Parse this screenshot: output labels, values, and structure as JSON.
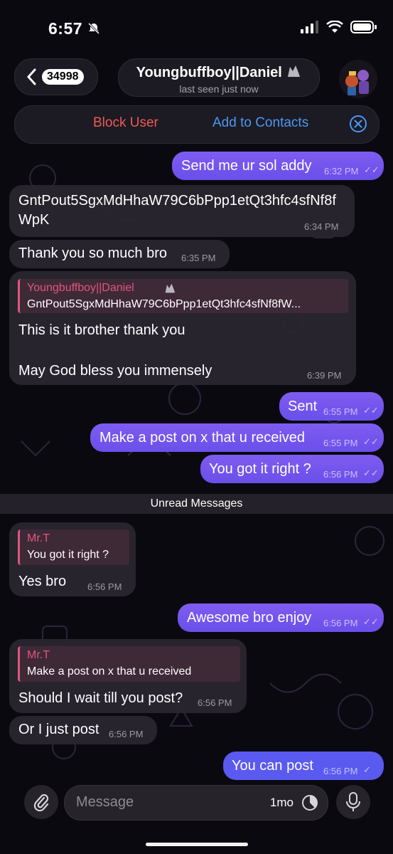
{
  "status_bar": {
    "time": "6:57"
  },
  "header": {
    "unread_count": "34998",
    "chat_title": "Youngbuffboy||Daniel",
    "last_seen": "last seen just now"
  },
  "actions": {
    "block": "Block User",
    "add_contact": "Add to Contacts"
  },
  "messages": [
    {
      "text": "Send me ur sol addy",
      "time": "6:32 PM"
    },
    {
      "text": "GntPout5SgxMdHhaW79C6bPpp1etQt3hfc4sfNf8fWpK",
      "time": "6:34 PM"
    },
    {
      "text": "Thank you so much bro",
      "time": "6:35 PM"
    },
    {
      "reply_name": "Youngbuffboy||Daniel",
      "reply_text": "GntPout5SgxMdHhaW79C6bPpp1etQt3hfc4sfNf8fW...",
      "text": "This is it brother thank you",
      "text2": "May God bless you immensely",
      "time": "6:39 PM"
    },
    {
      "text": "Sent",
      "time": "6:55 PM"
    },
    {
      "text": "Make a post on x that u received",
      "time": "6:55 PM"
    },
    {
      "text": "You got it right ?",
      "time": "6:56 PM"
    },
    {
      "reply_name": "Mr.T",
      "reply_text": "You got it right ?",
      "text": "Yes bro",
      "time": "6:56 PM"
    },
    {
      "text": "Awesome bro enjoy",
      "time": "6:56 PM"
    },
    {
      "reply_name": "Mr.T",
      "reply_text": "Make a post on x that u received",
      "text": "Should I wait till you post?",
      "time": "6:56 PM"
    },
    {
      "text": "Or I just post",
      "time": "6:56 PM"
    },
    {
      "text": "You can post",
      "time": "6:56 PM"
    }
  ],
  "unread_banner": "Unread Messages",
  "composer": {
    "placeholder": "Message",
    "timer": "1mo"
  },
  "colors": {
    "outgoing": "#7b5cf0",
    "incoming": "#2a2630",
    "block": "#ec5a57",
    "link": "#4d97f4"
  }
}
